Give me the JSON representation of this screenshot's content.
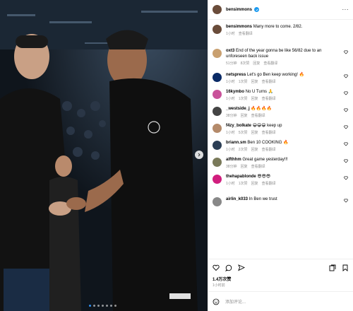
{
  "post": {
    "username": "bensimmons",
    "caption": "Many more to come. 2/82.",
    "caption_time": "1小时",
    "translate_label": "查看翻译",
    "reply_label": "回复",
    "likes": "1.4万次赞",
    "posted": "1小时前",
    "add_comment_placeholder": "添加评论..."
  },
  "comments": [
    {
      "user": "oxt3",
      "text": "End of the year gonna be like 56/82 due to an unforeseen back issue",
      "time": "51分钟",
      "likes": "8次赞",
      "avatar": "#c9a070"
    },
    {
      "user": "netspress",
      "text": "Let's go Ben keep working! 🔥",
      "time": "1小时",
      "likes": "1次赞",
      "avatar": "#0a2a66"
    },
    {
      "user": "16kymbo",
      "text": "No U Turns 🙏",
      "time": "1小时",
      "likes": "1次赞",
      "avatar": "#c9529a"
    },
    {
      "user": "_westside_j",
      "text": "🔥🔥🔥🔥",
      "time": "38分钟",
      "likes": "",
      "avatar": "#444"
    },
    {
      "user": "f4zy_bolkate",
      "text": "😁😁😁 keep up",
      "time": "1小时",
      "likes": "5次赞",
      "avatar": "#b48a6a"
    },
    {
      "user": "briann.sm",
      "text": "Ben 10 COOKING 🔥",
      "time": "1小时",
      "likes": "2次赞",
      "avatar": "#2c3e55"
    },
    {
      "user": "alfthhm",
      "text": "Great game yesterday!!!",
      "time": "38分钟",
      "likes": "",
      "avatar": "#7a7a5a"
    },
    {
      "user": "thehapablonde",
      "text": "😎😎😎",
      "time": "1小时",
      "likes": "1次赞",
      "avatar": "#d11e7e"
    },
    {
      "user": "airlin_k033",
      "text": "In Ben we trust",
      "time": "",
      "likes": "",
      "avatar": "#888"
    }
  ],
  "photo_alt": [
    "Yao Ming",
    "Ben Simmons"
  ],
  "carousel": {
    "count": 7,
    "active": 0
  }
}
